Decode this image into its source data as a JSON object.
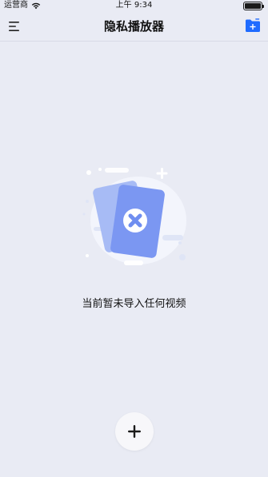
{
  "status_bar": {
    "carrier": "运营商",
    "time": "上午 9:34",
    "battery_level": 1.0
  },
  "nav": {
    "title": "隐私播放器",
    "left_icon": "menu-icon",
    "right_icon": "add-folder-icon"
  },
  "empty_state": {
    "message": "当前暂未导入任何视频",
    "icon": "empty-video-illustration"
  },
  "fab": {
    "icon": "plus-icon"
  },
  "colors": {
    "background": "#e9ebf4",
    "accent": "#1f6bff",
    "card_light": "#a7bbf5",
    "card_dark": "#6f8ef0"
  }
}
